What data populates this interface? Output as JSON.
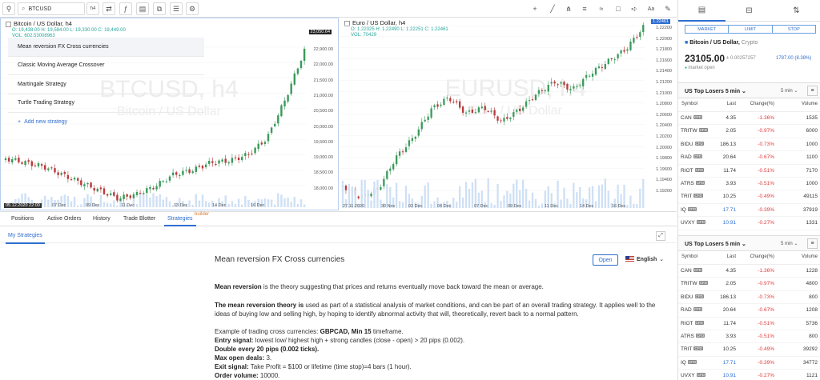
{
  "toolbar": {
    "symbol": "BTCUSD",
    "interval": "h4"
  },
  "chart1": {
    "title": "Bitcoin / US Dollar, h4",
    "ohlc": "O: 19,438.00  H: 19,584.00  L: 19,330.00  C: 19,449.00",
    "vol": "VOL: 602.53008963",
    "watermark_main": "BTCUSD, h4",
    "watermark_sub": "Bitcoin / US Dollar",
    "last_price": "23,050.64",
    "yticks": [
      "22,900.00",
      "22,000.00",
      "21,500.00",
      "21,000.00",
      "20,500.00",
      "20,000.00",
      "19,500.00",
      "19,000.00",
      "18,500.00",
      "18,000.00"
    ],
    "xticks": [
      "05.12.2020  22:00",
      "07 Dec",
      "09 Dec",
      "11 Dec",
      "13 Dec",
      "14 Dec",
      "16 Dec"
    ]
  },
  "chart2": {
    "title": "Euro / US Dollar, h4",
    "ohlc": "O: 1.22325  H: 1.22490  L: 1.22251  C: 1.22461",
    "vol": "VOL: 70429",
    "watermark_main": "EURUSD, h4",
    "watermark_sub": "Euro / US Dollar",
    "last_price": "1.22461",
    "yticks": [
      "1.22200",
      "1.22000",
      "1.21800",
      "1.21600",
      "1.21400",
      "1.21200",
      "1.21000",
      "1.20800",
      "1.20600",
      "1.20400",
      "1.20200",
      "1.20000",
      "1.19800",
      "1.19600",
      "1.19400",
      "1.19200"
    ],
    "xticks": [
      "27.11.2020",
      "30 Nov",
      "02 Dec",
      "04 Dec",
      "07 Dec",
      "09 Dec",
      "11 Dec",
      "14 Dec",
      "16 Dec"
    ]
  },
  "bottom_tabs": [
    "Positions",
    "Active Orders",
    "History",
    "Trade Blotter",
    "Strategies"
  ],
  "builder_tag": "builder",
  "my_strategies_tab": "My Strategies",
  "strategies": [
    "Mean reversion FX Cross currencies",
    "Classic Moving Average Crossover",
    "Martingale Strategy",
    "Turtle Trading Strategy"
  ],
  "add_strategy": "Add new strategy",
  "detail": {
    "title": "Mean reversion FX Cross currencies",
    "open_label": "Open",
    "language": "English",
    "p1_bold": "Mean reversion",
    "p1_rest": " is the theory suggesting that prices and returns eventually move back toward the mean or average.",
    "p2_bold": "The mean reversion theory is",
    "p2_rest": " used as part of a statistical analysis of market conditions, and can be part of an overall trading strategy. It applies well to the ideas of buying low and selling high, by hoping to identify abnormal activity that will, theoretically, revert back to a normal pattern.",
    "example_prefix": "Example of trading cross currencies: ",
    "example_bold": "GBPCAD, Min 15",
    "example_suffix": " timeframe.",
    "entry_label": "Entry signal:",
    "entry_text": " lowest low/ highest high + strong candles (close - open) > 20 pips (0.002).",
    "double_text": "Double every 20 pips (0.002 ticks).",
    "maxopen_label": "Max open deals:",
    "maxopen_value": " 3.",
    "exit_label": "Exit signal:",
    "exit_text": " Take Profit = $100 or lifetime (time stop)=4 bars (1 hour).",
    "order_label": "Order volume:",
    "order_value": " 10000."
  },
  "order_panel": {
    "types": [
      "MARKET",
      "LIMIT",
      "STOP"
    ],
    "symbol_name": "Bitcoin / US Dollar,",
    "symbol_sub": " Crypto",
    "price": "23105.00",
    "change_raw": "± 0.00257257",
    "change_pct": "1787.00 (8.38%)",
    "market_status": "market open"
  },
  "losers1": {
    "title": "US Top Losers 5 min",
    "interval": "5 min",
    "columns": [
      "Symbol",
      "Last",
      "Change(%)",
      "Volume"
    ],
    "rows": [
      [
        "CAN",
        "4.35",
        "-1.36%",
        "1535"
      ],
      [
        "TRITW",
        "2.05",
        "-0.97%",
        "6000"
      ],
      [
        "BIDU",
        "186.13",
        "-0.73%",
        "1000"
      ],
      [
        "RAD",
        "20.64",
        "-0.67%",
        "1100"
      ],
      [
        "RIOT",
        "11.74",
        "-0.51%",
        "7170"
      ],
      [
        "ATRS",
        "3.93",
        "-0.51%",
        "1000"
      ],
      [
        "TRIT",
        "10.25",
        "-0.49%",
        "49115"
      ],
      [
        "IQ",
        "17.71",
        "-0.39%",
        "37919"
      ],
      [
        "UVXY",
        "10.91",
        "-0.27%",
        "1331"
      ]
    ]
  },
  "losers2": {
    "title": "US Top Losers 5 min",
    "interval": "5 min",
    "columns": [
      "Symbol",
      "Last",
      "Change(%)",
      "Volume"
    ],
    "rows": [
      [
        "CAN",
        "4.35",
        "-1.36%",
        "1228"
      ],
      [
        "TRITW",
        "2.05",
        "-0.97%",
        "4800"
      ],
      [
        "BIDU",
        "186.13",
        "-0.73%",
        "800"
      ],
      [
        "RAD",
        "20.64",
        "-0.67%",
        "1208"
      ],
      [
        "RIOT",
        "11.74",
        "-0.51%",
        "5736"
      ],
      [
        "ATRS",
        "3.93",
        "-0.51%",
        "800"
      ],
      [
        "TRIT",
        "10.25",
        "-0.49%",
        "39292"
      ],
      [
        "IQ",
        "17.71",
        "-0.39%",
        "34772"
      ],
      [
        "UVXY",
        "10.91",
        "-0.27%",
        "1121"
      ]
    ]
  },
  "cfd_badge": "CFD",
  "colors": {
    "accent": "#2f6fcf",
    "up": "#26a69a",
    "down": "#c0392b",
    "loss": "#e03c3c"
  }
}
